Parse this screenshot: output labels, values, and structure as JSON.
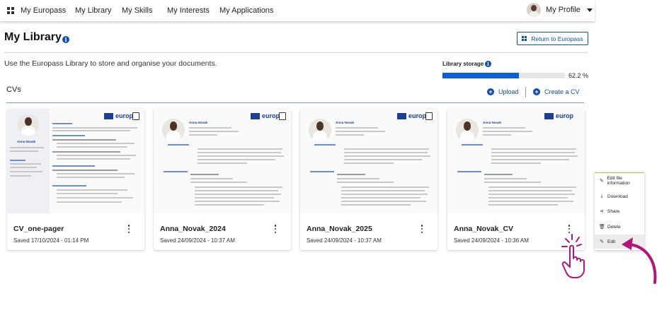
{
  "nav": {
    "items": [
      "My Europass",
      "My Library",
      "My Skills",
      "My Interests",
      "My Applications"
    ],
    "profile_label": "My Profile"
  },
  "header": {
    "title": "My Library",
    "info_glyph": "i",
    "return_label": "Return to Europass"
  },
  "description": "Use the Europass Library to store and organise your documents.",
  "storage": {
    "label": "Library storage",
    "percent_text": "62.2 %",
    "fraction": 0.622
  },
  "cvs": {
    "title": "CVs",
    "upload_label": "Upload",
    "create_label": "Create a CV",
    "cards": [
      {
        "title": "CV_one-pager",
        "saved": "Saved 17/10/2024 - 01:14 PM"
      },
      {
        "title": "Anna_Novak_2024",
        "saved": "Saved 24/09/2024 - 10:37 AM"
      },
      {
        "title": "Anna_Novak_2025",
        "saved": "Saved 24/09/2024 - 10:37 AM"
      },
      {
        "title": "Anna_Novak_CV",
        "saved": "Saved 24/09/2024 - 10:36 AM"
      }
    ],
    "preview": {
      "brand": "europ",
      "person_name": "Anna Novak"
    }
  },
  "context_menu": {
    "items": [
      {
        "label": "Edit file information",
        "icon": "pencil-icon",
        "glyph": "✎"
      },
      {
        "label": "Download",
        "icon": "download-icon",
        "glyph": "⤓"
      },
      {
        "label": "Share",
        "icon": "share-icon",
        "glyph": "⋖"
      },
      {
        "label": "Delete",
        "icon": "trash-icon",
        "glyph": "🗑"
      },
      {
        "label": "Edit",
        "icon": "edit-icon",
        "glyph": "✎"
      }
    ]
  },
  "colors": {
    "accent": "#0f4fa8",
    "storage_fill": "#0b5fd6",
    "annotation": "#b0177a"
  }
}
